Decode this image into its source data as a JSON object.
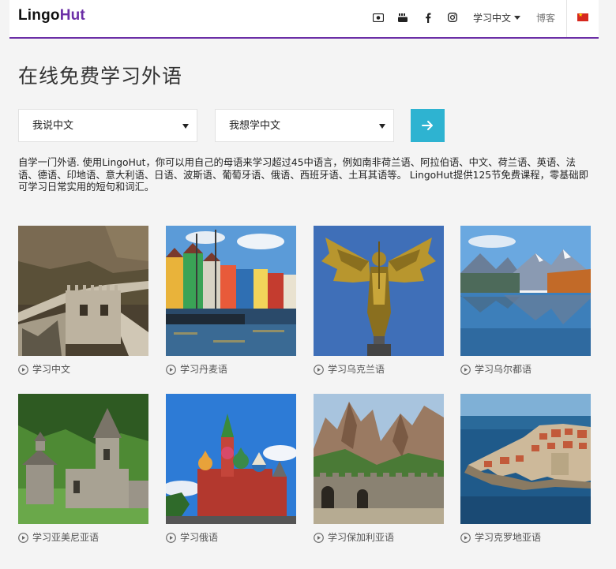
{
  "header": {
    "logo_part1": "Lingo",
    "logo_part2": "Hut",
    "icons": [
      "video-icon",
      "youtube-icon",
      "facebook-icon",
      "instagram-icon"
    ],
    "language_menu": "学习中文",
    "blog": "博客",
    "flag": "china-flag-icon",
    "accent_color": "#6b2ea6"
  },
  "main": {
    "title": "在线免费学习外语",
    "speak_select": "我说中文",
    "learn_select": "我想学中文",
    "go_button_color": "#2eb3d1",
    "go_icon": "arrow-right-icon",
    "intro": "自学一门外语. 使用LingoHut，你可以用自己的母语来学习超过45中语言，例如南非荷兰语、阿拉伯语、中文、荷兰语、英语、法语、德语、印地语、意大利语、日语、波斯语、葡萄牙语、俄语、西班牙语、土耳其语等。 LingoHut提供125节免费课程，零基础即可学习日常实用的短句和词汇。"
  },
  "courses": [
    {
      "label": "学习中文",
      "scene": "great-wall"
    },
    {
      "label": "学习丹麦语",
      "scene": "copenhagen-harbor"
    },
    {
      "label": "学习乌克兰语",
      "scene": "golden-archangel-statue"
    },
    {
      "label": "学习乌尔都语",
      "scene": "mountain-lake"
    },
    {
      "label": "学习亚美尼亚语",
      "scene": "armenian-monastery"
    },
    {
      "label": "学习俄语",
      "scene": "st-basils-cathedral"
    },
    {
      "label": "学习保加利亚语",
      "scene": "belogradchik-fortress"
    },
    {
      "label": "学习克罗地亚语",
      "scene": "dubrovnik-coast"
    }
  ]
}
